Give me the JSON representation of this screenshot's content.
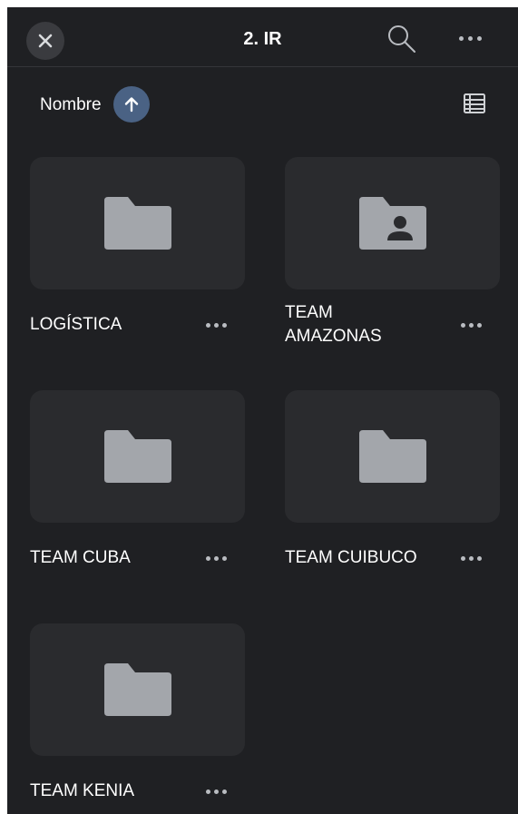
{
  "header": {
    "title": "2. IR",
    "close_icon": "close-icon",
    "search_icon": "search-icon",
    "more_icon": "more-horizontal-icon"
  },
  "sort": {
    "label": "Nombre",
    "direction_icon": "arrow-up-icon",
    "view_icon": "list-view-icon"
  },
  "items": [
    {
      "label": "LOGÍSTICA",
      "icon": "folder-icon"
    },
    {
      "label": "TEAM\nAMAZONAS",
      "icon": "shared-folder-icon"
    },
    {
      "label": "TEAM CUBA",
      "icon": "folder-icon"
    },
    {
      "label": "TEAM CUIBUCO",
      "icon": "folder-icon"
    },
    {
      "label": "TEAM KENIA",
      "icon": "folder-icon"
    }
  ],
  "colors": {
    "background": "#1f2023",
    "card": "#2a2b2e",
    "folder": "#a3a6ab",
    "sort_button": "#4a6284"
  }
}
